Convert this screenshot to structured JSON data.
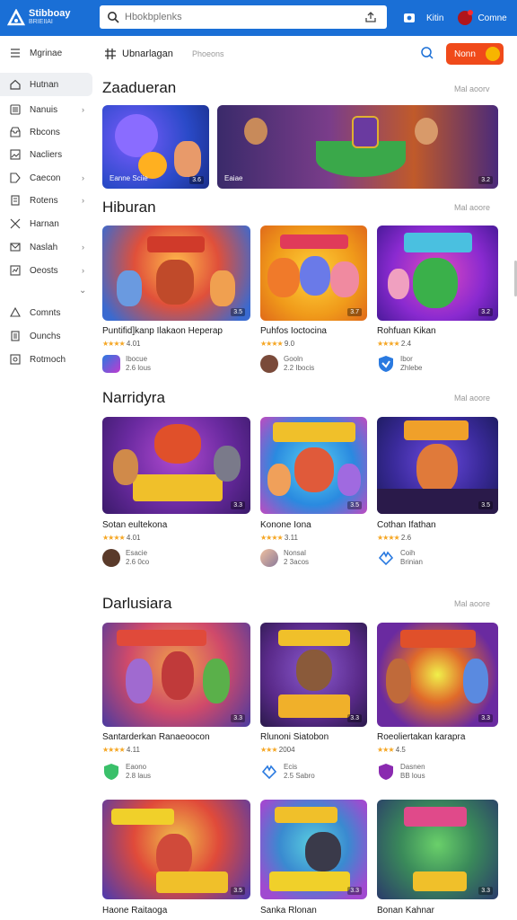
{
  "app": {
    "logo_line1": "Stibboay",
    "logo_line2": "BRIEIIAI",
    "search_placeholder": "Hbokbplenks",
    "nav_label1": "Kitin",
    "nav_label2": "Comne",
    "brand_color": "#1a6fd6"
  },
  "sidebar": {
    "items": [
      {
        "label": "Mgrinae",
        "icon": "menu-icon",
        "chevron": false
      },
      {
        "label": "Hutnan",
        "icon": "home-icon",
        "chevron": false
      },
      {
        "label": "Nanuis",
        "icon": "list-icon",
        "chevron": true
      },
      {
        "label": "Rbcons",
        "icon": "inbox-icon",
        "chevron": false
      },
      {
        "label": "Nacliers",
        "icon": "image-icon",
        "chevron": false
      },
      {
        "label": "Caecon",
        "icon": "tag-icon",
        "chevron": true
      },
      {
        "label": "Rotens",
        "icon": "doc-icon",
        "chevron": true
      },
      {
        "label": "Harnan",
        "icon": "tools-icon",
        "chevron": false
      },
      {
        "label": "Naslah",
        "icon": "mail-icon",
        "chevron": true
      },
      {
        "label": "Oeosts",
        "icon": "chart-icon",
        "chevron": true
      },
      {
        "label": "Comnts",
        "icon": "star-icon",
        "chevron": false
      },
      {
        "label": "Ounchs",
        "icon": "file-icon",
        "chevron": false
      },
      {
        "label": "Rotmoch",
        "icon": "settings-icon",
        "chevron": false
      }
    ],
    "more_label": "⌄"
  },
  "subheader": {
    "title": "Ubnarlagan",
    "subtitle": "Phoeons",
    "button_label": "Nonn"
  },
  "sections": [
    {
      "title": "Zaadueran",
      "more": "Mal aoorv",
      "cards": [
        {
          "overlay": "Eanne Sciie",
          "badge": "3.6"
        },
        {
          "overlay": "Eaiae",
          "badge": "3.2"
        }
      ]
    },
    {
      "title": "Hiburan",
      "more": "Mal aoore",
      "cards": [
        {
          "badge": "3.5",
          "title": "Puntifid]kanp Ilakaon Heperap",
          "rating": "4.01",
          "meta1": "Ibocue",
          "meta2": "2.6 lous"
        },
        {
          "badge": "3.7",
          "title": "Puhfos Ioctocina",
          "rating": "9.0",
          "meta1": "Gooln",
          "meta2": "2.2 Ibocis"
        },
        {
          "badge": "3.2",
          "title": "Rohfuan Kikan",
          "rating": "2.4",
          "meta1": "Ibor",
          "meta2": "Zhlebe"
        }
      ]
    },
    {
      "title": "Narridyra",
      "more": "Mal aoore",
      "cards": [
        {
          "badge": "3.3",
          "title": "Sotan eultekona",
          "rating": "4.01",
          "meta1": "Esacie",
          "meta2": "2.6 0co"
        },
        {
          "badge": "3.5",
          "title": "Konone Iona",
          "rating": "3.11",
          "meta1": "Nonsal",
          "meta2": "2 3acos"
        },
        {
          "badge": "3.5",
          "title": "Cothan Ifathan",
          "rating": "2.6",
          "meta1": "Coih",
          "meta2": "Brinian"
        }
      ]
    },
    {
      "title": "Darlusiara",
      "more": "Mal aoore",
      "cards": [
        {
          "badge": "3.3",
          "title": "Santarderkan Ranaeoocon",
          "rating": "4.11",
          "meta1": "Eaono",
          "meta2": "2.8 laus"
        },
        {
          "badge": "3.3",
          "title": "Rlunoni Siatobon",
          "rating": "2004",
          "meta1": "Ecis",
          "meta2": "2.5 Sabro"
        },
        {
          "badge": "3.3",
          "title": "Roeoliertakan karapra",
          "rating": "4.5",
          "meta1": "Dasnen",
          "meta2": "BB lous"
        }
      ]
    },
    {
      "title": "",
      "more": "",
      "cards": [
        {
          "badge": "3.5",
          "title": "Haone Raitaoga"
        },
        {
          "badge": "3.3",
          "title": "Sanka Rlonan"
        },
        {
          "badge": "3.3",
          "title": "Bonan Kahnar"
        }
      ]
    }
  ]
}
